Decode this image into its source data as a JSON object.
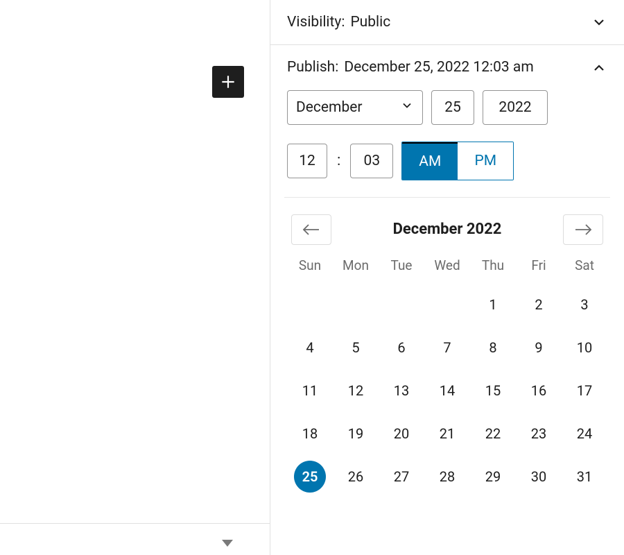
{
  "visibility": {
    "label": "Visibility:",
    "value": "Public"
  },
  "publish": {
    "label": "Publish:",
    "value": "December 25, 2022 12:03 am"
  },
  "datetime": {
    "month": "December",
    "day": "25",
    "year": "2022",
    "hour": "12",
    "minute": "03",
    "colon": ":",
    "am_label": "AM",
    "pm_label": "PM",
    "ampm_selected": "AM"
  },
  "calendar": {
    "title": "December 2022",
    "dow": [
      "Sun",
      "Mon",
      "Tue",
      "Wed",
      "Thu",
      "Fri",
      "Sat"
    ],
    "first_weekday": 4,
    "days_in_month": 31,
    "selected_day": 25
  }
}
